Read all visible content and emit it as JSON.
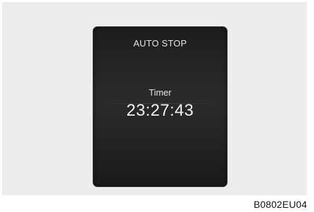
{
  "display": {
    "mode_label": "AUTO STOP",
    "timer_label": "Timer",
    "timer_value": "23:27:43"
  },
  "figure_code": "B0802EU04"
}
